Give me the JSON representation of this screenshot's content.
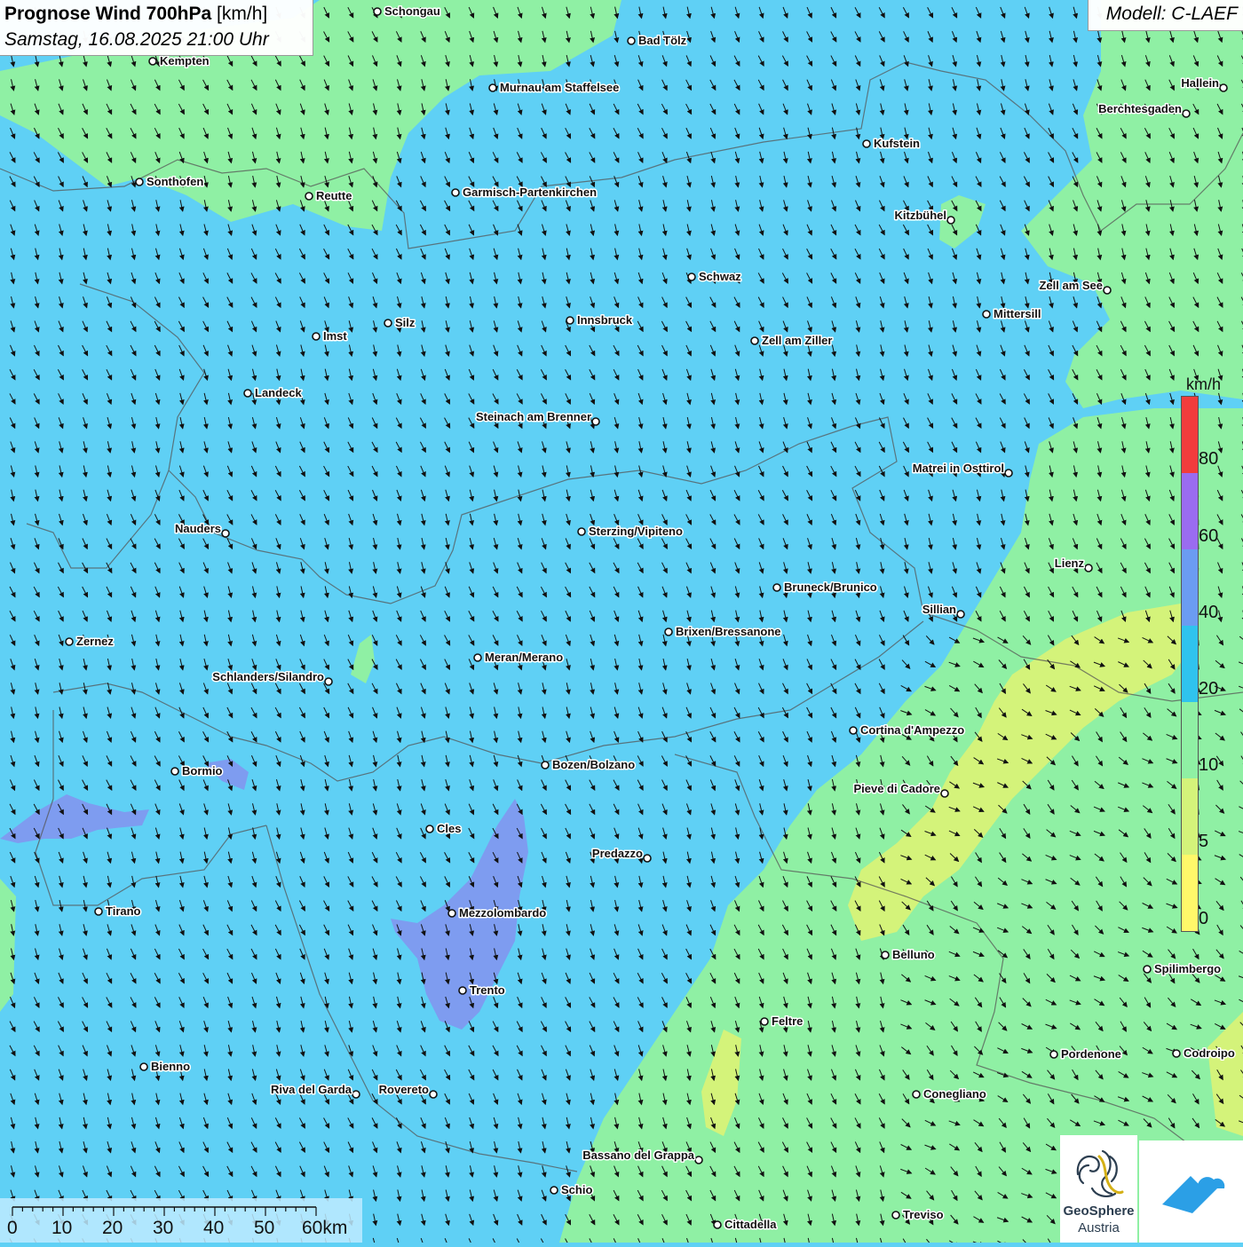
{
  "header": {
    "title_bold": "Prognose Wind 700hPa",
    "title_unit": " [km/h]",
    "subtitle": "Samstag, 16.08.2025 21:00 Uhr"
  },
  "model": "Modell: C-LAEF",
  "legend": {
    "unit": "km/h",
    "ticks": [
      "0",
      "5",
      "10",
      "20",
      "40",
      "60",
      "80"
    ],
    "colors": {
      "0-5": "#fff86a",
      "5-10": "#d4f37a",
      "10-20": "#8ff0a4",
      "20-40": "#3ec8f0",
      "40-60": "#6b9cf2",
      "60-80": "#9a6cf0",
      "80+": "#f23c3c"
    }
  },
  "scale_bar": {
    "labels": [
      "0",
      "10",
      "20",
      "30",
      "40",
      "50",
      "60km"
    ]
  },
  "logos": {
    "geosphere_name": "GeoSphere",
    "geosphere_sub": "Austria"
  },
  "cities": [
    {
      "name": "Schongau"
    },
    {
      "name": "Bad Tölz"
    },
    {
      "name": "Kempten"
    },
    {
      "name": "Murnau am Staffelsee"
    },
    {
      "name": "Hallein"
    },
    {
      "name": "Berchtesgaden"
    },
    {
      "name": "Kufstein"
    },
    {
      "name": "Sonthofen"
    },
    {
      "name": "Reutte"
    },
    {
      "name": "Garmisch-Partenkirchen"
    },
    {
      "name": "Kitzbühel"
    },
    {
      "name": "Schwaz"
    },
    {
      "name": "Zell am See"
    },
    {
      "name": "Mittersill"
    },
    {
      "name": "Innsbruck"
    },
    {
      "name": "Silz"
    },
    {
      "name": "Imst"
    },
    {
      "name": "Zell am Ziller"
    },
    {
      "name": "Landeck"
    },
    {
      "name": "Steinach am Brenner"
    },
    {
      "name": "Matrei in Osttirol"
    },
    {
      "name": "Nauders"
    },
    {
      "name": "Sterzing/Vipiteno"
    },
    {
      "name": "Lienz"
    },
    {
      "name": "Bruneck/Brunico"
    },
    {
      "name": "Sillian"
    },
    {
      "name": "Brixen/Bressanone"
    },
    {
      "name": "Zernez"
    },
    {
      "name": "Meran/Merano"
    },
    {
      "name": "Schlanders/Silandro"
    },
    {
      "name": "Cortina d'Ampezzo"
    },
    {
      "name": "Bormio"
    },
    {
      "name": "Bozen/Bolzano"
    },
    {
      "name": "Pieve di Cadore"
    },
    {
      "name": "Cles"
    },
    {
      "name": "Predazzo"
    },
    {
      "name": "Tirano"
    },
    {
      "name": "Mezzolombardo"
    },
    {
      "name": "Belluno"
    },
    {
      "name": "Spilimbergo"
    },
    {
      "name": "Trento"
    },
    {
      "name": "Feltre"
    },
    {
      "name": "Pordenone"
    },
    {
      "name": "Codroipo"
    },
    {
      "name": "Bienno"
    },
    {
      "name": "Riva del Garda"
    },
    {
      "name": "Rovereto"
    },
    {
      "name": "Conegliano"
    },
    {
      "name": "Bassano del Grappa"
    },
    {
      "name": "Schio"
    },
    {
      "name": "Treviso"
    },
    {
      "name": "Cittadella"
    }
  ]
}
